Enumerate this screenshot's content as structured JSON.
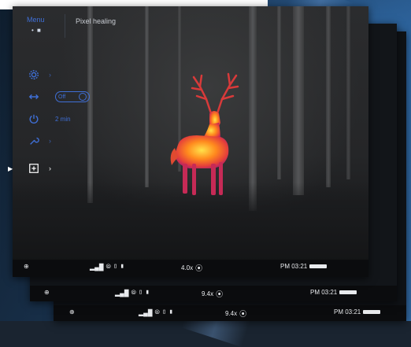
{
  "menu": {
    "title": "Menu",
    "dots": "• ■",
    "header": "Pixel healing",
    "items": [
      {
        "icon": "gear-icon"
      },
      {
        "icon": "pixel-adjust-icon",
        "toggle_label": "Off"
      },
      {
        "icon": "power-icon",
        "value": "2 min"
      },
      {
        "icon": "wrench-icon"
      },
      {
        "icon": "add-square-icon"
      }
    ],
    "arrow": "›",
    "selector": "▶"
  },
  "status": {
    "main": {
      "signal": "▂▄█",
      "mode": "⦾ ▯ ▮",
      "zoom": "4.0x",
      "time": "PM 03:21",
      "wifi": "⦿"
    },
    "back1": {
      "signal": "▂▄█",
      "mode": "⦾ ▯ ▮",
      "zoom": "9.4x",
      "time": "PM 03:21",
      "wifi": "⦿"
    },
    "back2": {
      "signal": "▂▄█",
      "mode": "⦾ ▯ ▮",
      "zoom": "9.4x",
      "time": "PM 03:21",
      "wifi": "⦿"
    }
  },
  "colors": {
    "accent": "#3f6fd6",
    "thermal_hot": "#ffd23a",
    "thermal_mid": "#ff6a1a",
    "thermal_cool": "#c4226e"
  }
}
